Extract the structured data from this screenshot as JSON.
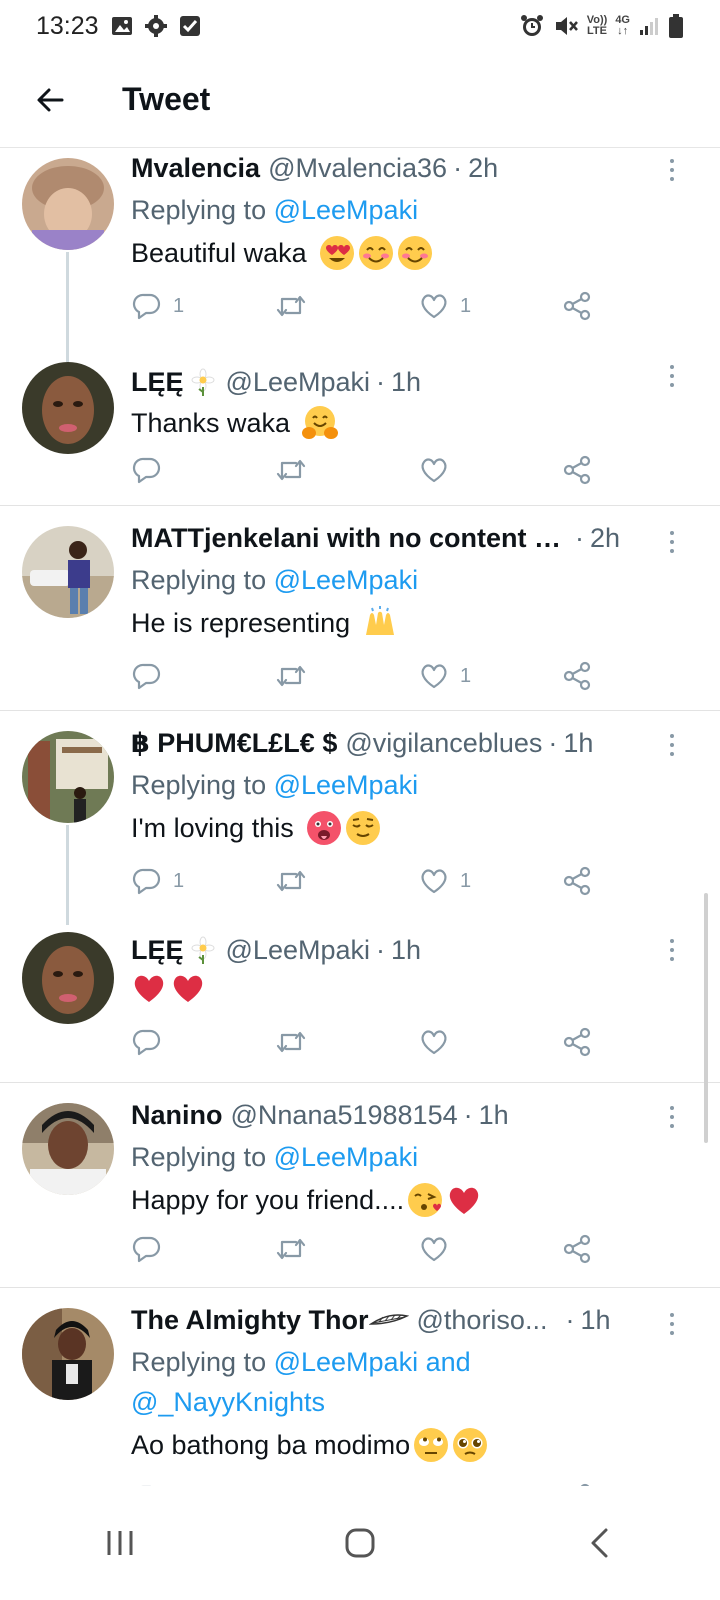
{
  "status_bar": {
    "time": "13:23",
    "left_icons": [
      "gallery-icon",
      "gear-icon",
      "checkbox-icon"
    ],
    "right_icons": [
      "alarm-icon",
      "mute-icon",
      "volte-icon",
      "4g-icon",
      "signal-icon",
      "battery-icon"
    ],
    "volte_top": "Vo))",
    "volte_bottom": "LTE",
    "net_top": "4G",
    "net_bottom": "↓↑"
  },
  "header": {
    "title": "Tweet",
    "back_icon": "back-arrow-icon"
  },
  "tweets": [
    {
      "name": "Mvalencia",
      "handle": "@Mvalencia36",
      "time": "2h",
      "reply_prefix": "Replying to ",
      "reply_mentions": "@LeeMpaki",
      "text": "Beautiful waka",
      "emojis": [
        "heart-eyes-emoji",
        "smiling-emoji",
        "smiling-emoji"
      ],
      "replies": "1",
      "retweets": "",
      "likes": "1"
    },
    {
      "name": "LĘĘ",
      "name_emoji": "daisy-emoji",
      "handle": "@LeeMpaki",
      "time": "1h",
      "text": "Thanks waka",
      "emojis": [
        "hugging-emoji"
      ],
      "replies": "",
      "retweets": "",
      "likes": ""
    },
    {
      "name": "MATTjenkelani with no content …",
      "handle": "",
      "time": "2h",
      "reply_prefix": "Replying to ",
      "reply_mentions": "@LeeMpaki",
      "text": "He is representing",
      "emojis": [
        "raised-hands-emoji"
      ],
      "replies": "",
      "retweets": "",
      "likes": "1"
    },
    {
      "name": "฿ PHUM€L£L€ $",
      "handle": "@vigilanceblues",
      "time": "1h",
      "reply_prefix": "Replying to ",
      "reply_mentions": "@LeeMpaki",
      "text": "I'm loving this",
      "emojis": [
        "hot-face-emoji",
        "relieved-emoji"
      ],
      "replies": "1",
      "retweets": "",
      "likes": "1"
    },
    {
      "name": "LĘĘ",
      "name_emoji": "daisy-emoji",
      "handle": "@LeeMpaki",
      "time": "1h",
      "text": "",
      "emojis": [
        "red-heart-emoji",
        "red-heart-emoji"
      ],
      "replies": "",
      "retweets": "",
      "likes": ""
    },
    {
      "name": "Nanino",
      "handle": "@Nnana51988154",
      "time": "1h",
      "reply_prefix": "Replying to ",
      "reply_mentions": "@LeeMpaki",
      "text": "Happy for you friend....",
      "emojis": [
        "kissing-heart-emoji",
        "red-heart-emoji"
      ],
      "replies": "",
      "retweets": "",
      "likes": ""
    },
    {
      "name": "The Almighty Thor",
      "name_emoji": "feather-emoji",
      "handle": "@thoriso...",
      "time": "1h",
      "reply_prefix": "Replying to ",
      "reply_mentions": "@LeeMpaki and",
      "reply_mentions_2": "@_NayyKnights",
      "text": "Ao bathong ba modimo",
      "emojis": [
        "rolling-eyes-emoji",
        "pleading-emoji"
      ],
      "replies": "",
      "retweets": "",
      "likes": ""
    }
  ],
  "action_icons": [
    "reply-icon",
    "retweet-icon",
    "like-icon",
    "share-icon"
  ],
  "nav_bar": {
    "icons": [
      "recent-apps-icon",
      "home-icon",
      "nav-back-icon"
    ]
  },
  "colors": {
    "accent": "#1d9bf0",
    "secondary_text": "#536471",
    "icon_gray": "#8899a6"
  }
}
